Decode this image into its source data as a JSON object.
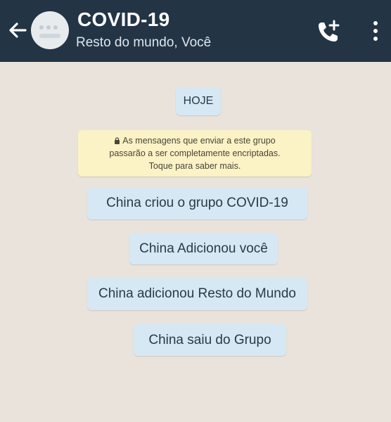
{
  "header": {
    "back_icon": "arrow-left-icon",
    "avatar_icon": "group-avatar-icon",
    "title": "COVID-19",
    "subtitle": "Resto do mundo, Você",
    "call_icon": "add-call-icon",
    "menu_icon": "more-vertical-icon",
    "background_color": "#233445"
  },
  "chat": {
    "date_label": "HOJE",
    "encryption_notice": {
      "icon": "lock-icon",
      "line1": "As mensagens que enviar a este grupo",
      "line2": "passarão a ser completamente encriptadas.",
      "line3": "Toque para saber mais."
    },
    "system_messages": [
      "China criou o grupo COVID-19",
      "China Adicionou você",
      "China adicionou Resto do Mundo",
      "China saiu do Grupo"
    ],
    "colors": {
      "background": "#e9e3db",
      "system_pill": "#d6e8f4",
      "notice": "#fbf2c6"
    }
  }
}
